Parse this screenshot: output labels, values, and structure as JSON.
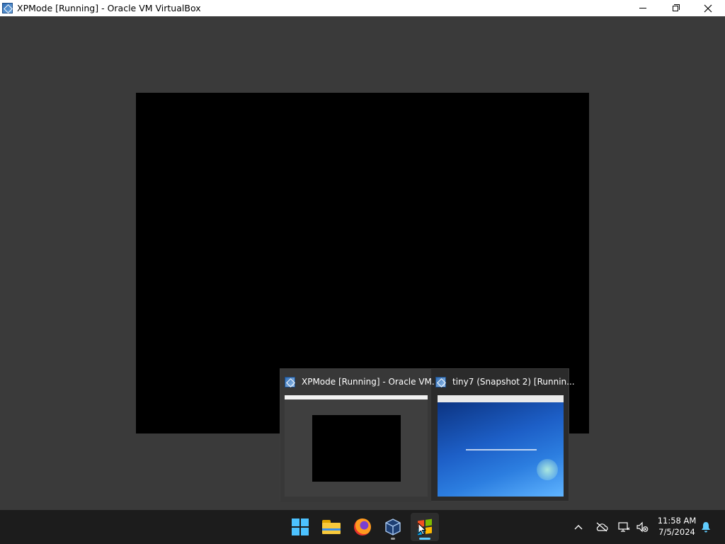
{
  "window": {
    "title": "XPMode [Running] - Oracle VM VirtualBox",
    "icon": "virtualbox-icon",
    "controls": [
      "minimize",
      "restore",
      "close"
    ]
  },
  "taskbar": {
    "apps": [
      {
        "name": "Start",
        "icon": "windows-start-icon"
      },
      {
        "name": "File Explorer",
        "icon": "folder-icon"
      },
      {
        "name": "Firefox",
        "icon": "firefox-icon"
      },
      {
        "name": "Oracle VM VirtualBox",
        "icon": "virtualbox-icon"
      },
      {
        "name": "XPMode",
        "icon": "windows-xp-icon",
        "active": true
      }
    ],
    "tray": {
      "icons": [
        "chevron-up-icon",
        "cloud-off-icon",
        "network-icon",
        "volume-muted-icon",
        "notification-bell-icon"
      ],
      "time": "11:58 AM",
      "date": "7/5/2024"
    }
  },
  "thumbnail_popup": {
    "items": [
      {
        "title": "XPMode [Running] - Oracle VM...",
        "preview_description": "xpmode-window-preview"
      },
      {
        "title": "tiny7 (Snapshot 2) [Runnin...",
        "preview_description": "windows7-desktop-preview"
      }
    ]
  },
  "colors": {
    "vm_background": "#3a3a3a",
    "vm_screen": "#000000",
    "taskbar": "#1c1c1c",
    "accent": "#60cdff"
  }
}
